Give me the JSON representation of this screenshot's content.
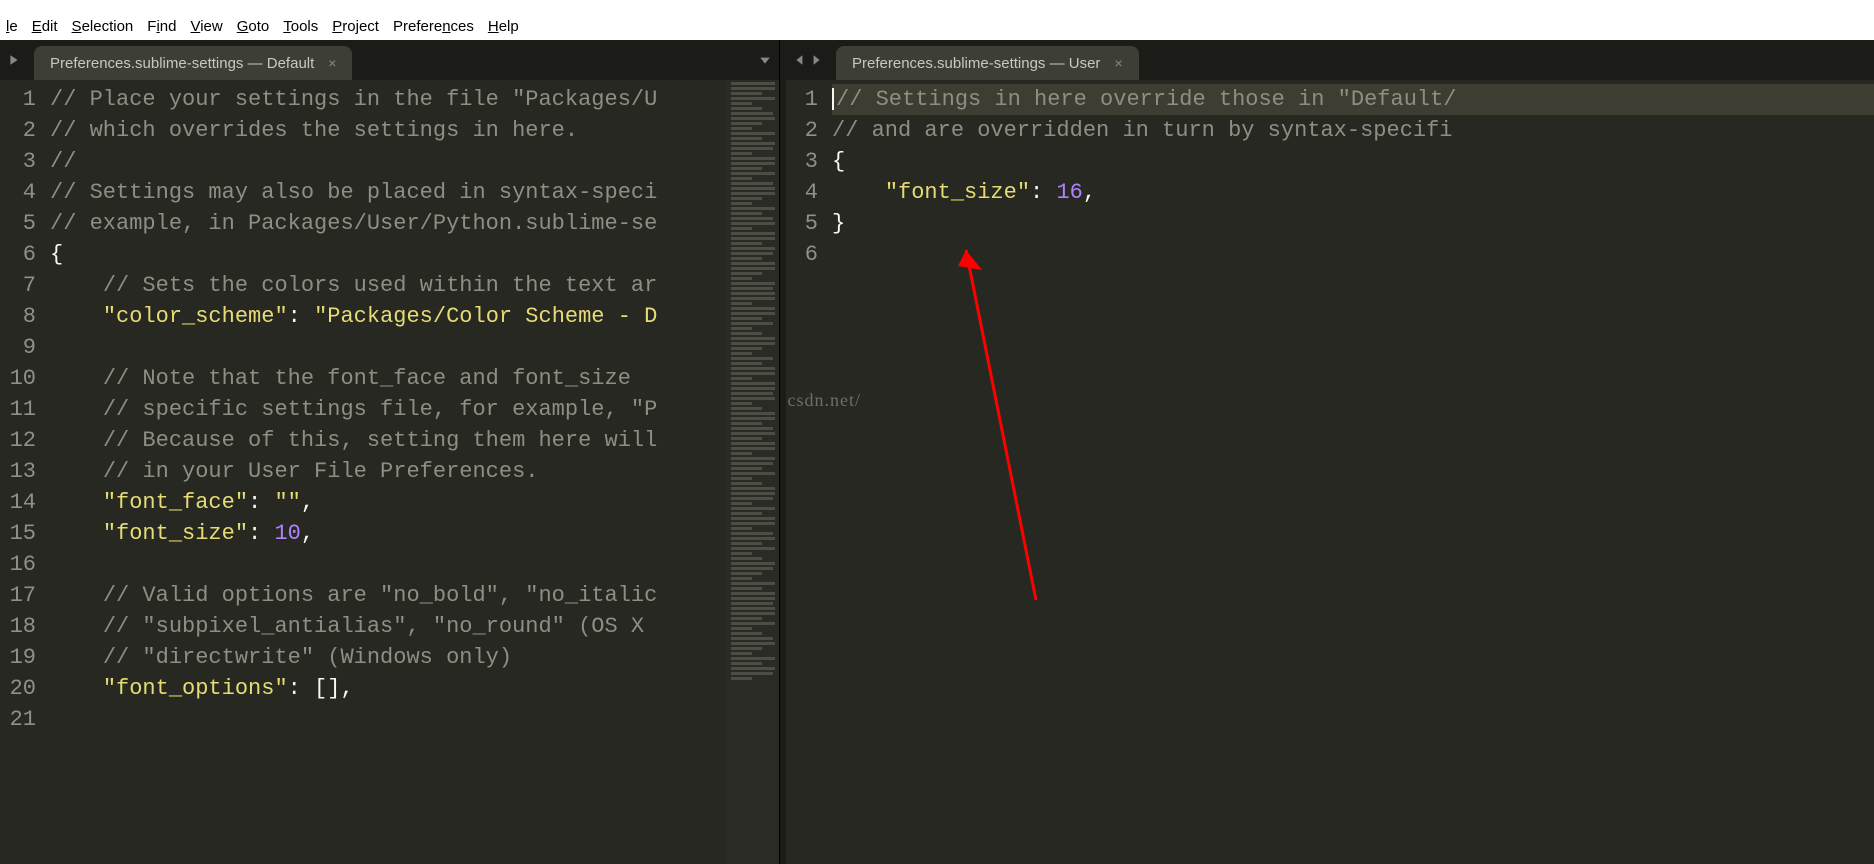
{
  "titlebar_fragment": "",
  "menu": {
    "file_html": "<span class=\"ul\">l</span>e",
    "edit_html": "<span class=\"ul\">E</span>dit",
    "selection_html": "<span class=\"ul\">S</span>election",
    "find_html": "F<span class=\"ul\">i</span>nd",
    "view_html": "<span class=\"ul\">V</span>iew",
    "goto_html": "<span class=\"ul\">G</span>oto",
    "tools_html": "<span class=\"ul\">T</span>ools",
    "project_html": "<span class=\"ul\">P</span>roject",
    "preferences_html": "Prefere<span class=\"ul\">n</span>ces",
    "help_html": "<span class=\"ul\">H</span>elp"
  },
  "panes": {
    "left": {
      "tab_label": "Preferences.sublime-settings — Default",
      "lines": [
        {
          "n": 1,
          "segs": [
            [
              "comment",
              "// Place your settings in the file \"Packages/U"
            ]
          ]
        },
        {
          "n": 2,
          "segs": [
            [
              "comment",
              "// which overrides the settings in here."
            ]
          ]
        },
        {
          "n": 3,
          "segs": [
            [
              "comment",
              "//"
            ]
          ]
        },
        {
          "n": 4,
          "segs": [
            [
              "comment",
              "// Settings may also be placed in syntax-speci"
            ]
          ]
        },
        {
          "n": 5,
          "segs": [
            [
              "comment",
              "// example, in Packages/User/Python.sublime-se"
            ]
          ]
        },
        {
          "n": 6,
          "segs": [
            [
              "punc",
              "{"
            ]
          ]
        },
        {
          "n": 7,
          "segs": [
            [
              "indent",
              "    "
            ],
            [
              "comment",
              "// Sets the colors used within the text ar"
            ]
          ]
        },
        {
          "n": 8,
          "segs": [
            [
              "indent",
              "    "
            ],
            [
              "key",
              "\"color_scheme\""
            ],
            [
              "punc",
              ": "
            ],
            [
              "str",
              "\"Packages/Color Scheme - D"
            ]
          ]
        },
        {
          "n": 9,
          "segs": []
        },
        {
          "n": 10,
          "segs": [
            [
              "indent",
              "    "
            ],
            [
              "comment",
              "// Note that the font_face and font_size"
            ]
          ]
        },
        {
          "n": 11,
          "segs": [
            [
              "indent",
              "    "
            ],
            [
              "comment",
              "// specific settings file, for example, \"P"
            ]
          ]
        },
        {
          "n": 12,
          "segs": [
            [
              "indent",
              "    "
            ],
            [
              "comment",
              "// Because of this, setting them here will"
            ]
          ]
        },
        {
          "n": 13,
          "segs": [
            [
              "indent",
              "    "
            ],
            [
              "comment",
              "// in your User File Preferences."
            ]
          ]
        },
        {
          "n": 14,
          "segs": [
            [
              "indent",
              "    "
            ],
            [
              "key",
              "\"font_face\""
            ],
            [
              "punc",
              ": "
            ],
            [
              "str",
              "\"\""
            ],
            [
              "punc",
              ","
            ]
          ]
        },
        {
          "n": 15,
          "segs": [
            [
              "indent",
              "    "
            ],
            [
              "key",
              "\"font_size\""
            ],
            [
              "punc",
              ": "
            ],
            [
              "num",
              "10"
            ],
            [
              "punc",
              ","
            ]
          ]
        },
        {
          "n": 16,
          "segs": []
        },
        {
          "n": 17,
          "segs": [
            [
              "indent",
              "    "
            ],
            [
              "comment",
              "// Valid options are \"no_bold\", \"no_italic"
            ]
          ]
        },
        {
          "n": 18,
          "segs": [
            [
              "indent",
              "    "
            ],
            [
              "comment",
              "// \"subpixel_antialias\", \"no_round\" (OS X "
            ]
          ]
        },
        {
          "n": 19,
          "segs": [
            [
              "indent",
              "    "
            ],
            [
              "comment",
              "// \"directwrite\" (Windows only)"
            ]
          ]
        },
        {
          "n": 20,
          "segs": [
            [
              "indent",
              "    "
            ],
            [
              "key",
              "\"font_options\""
            ],
            [
              "punc",
              ": [],"
            ]
          ]
        },
        {
          "n": 21,
          "segs": []
        }
      ]
    },
    "right": {
      "tab_label": "Preferences.sublime-settings — User",
      "lines": [
        {
          "n": 1,
          "hl": true,
          "cursor": true,
          "segs": [
            [
              "comment",
              "// Settings in here override those in \"Default/"
            ]
          ]
        },
        {
          "n": 2,
          "segs": [
            [
              "comment",
              "// and are overridden in turn by syntax-specifi"
            ]
          ]
        },
        {
          "n": 3,
          "segs": [
            [
              "punc",
              "{"
            ]
          ]
        },
        {
          "n": 4,
          "segs": [
            [
              "indent",
              "    "
            ],
            [
              "key",
              "\"font_size\""
            ],
            [
              "punc",
              ": "
            ],
            [
              "num",
              "16"
            ],
            [
              "punc",
              ","
            ]
          ]
        },
        {
          "n": 5,
          "segs": [
            [
              "punc",
              "}"
            ]
          ]
        },
        {
          "n": 6,
          "segs": []
        }
      ]
    }
  },
  "watermark": "http://blog.csdn.net/"
}
